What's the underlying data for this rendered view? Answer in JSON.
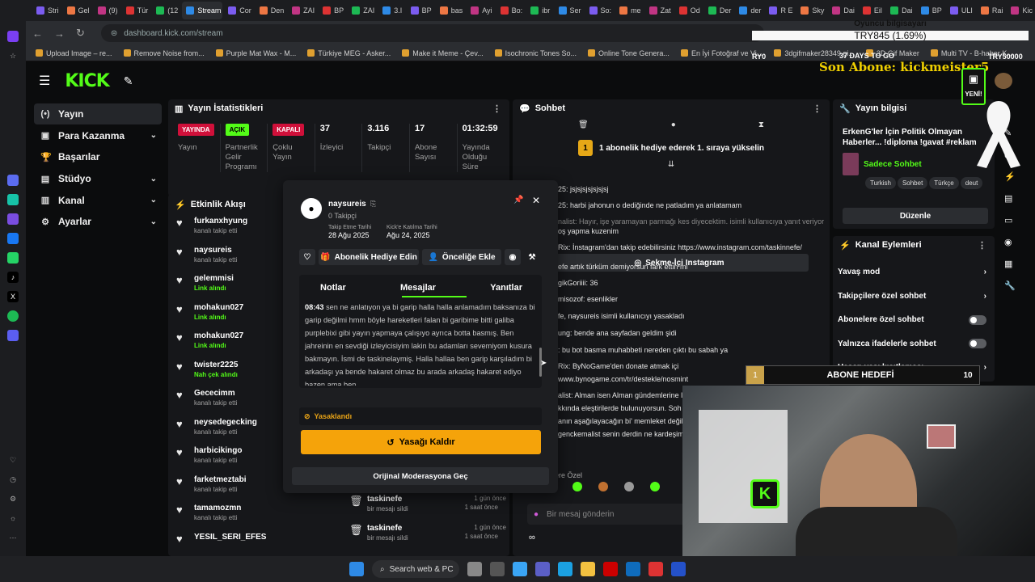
{
  "browser": {
    "tabs": [
      "Stri",
      "Gel",
      "(9)",
      "Tür",
      "(12",
      "Stream",
      "Cor",
      "Den",
      "ZAI",
      "BP",
      "ZAI",
      "3.I",
      "BP",
      "bas",
      "Ayi",
      "Bo:",
      "ibr",
      "Ser",
      "So:",
      "me",
      "Zat",
      "Od",
      "Der",
      "der",
      "R E",
      "Sky",
      "Dai",
      "Eil",
      "Dai",
      "BP",
      "ULI",
      "Rai",
      "Kic"
    ],
    "active_tab": "Stream",
    "url": "dashboard.kick.com/stream",
    "bookmarks": [
      "Upload Image – re...",
      "Remove Noise from...",
      "Purple Mat Wax - M...",
      "Türkiye MEG - Asker...",
      "Make it Meme - Çev...",
      "Isochronic Tones So...",
      "Online Tone Genera...",
      "En İyi Fotoğraf ve Vi...",
      "3dgifmaker28349.gi...",
      "3D Gif Maker",
      "Multi TV - B-haber K..."
    ]
  },
  "overlay": {
    "computer_label": "Oyuncu bilgisayarı",
    "goal_text": "TRY845 (1.69%)",
    "days_to_go": "37 DAYS TO GO",
    "goal_left": "RY0",
    "goal_right": "TRY50000",
    "last_sub": "Son Abone: kickmeister5",
    "new_label": "YENİ!"
  },
  "nav": {
    "items": [
      {
        "label": "Yayın",
        "icon": "(•)"
      },
      {
        "label": "Para Kazanma",
        "icon": "▣"
      },
      {
        "label": "Başarılar",
        "icon": "🏆"
      },
      {
        "label": "Stüdyo",
        "icon": "▤"
      },
      {
        "label": "Kanal",
        "icon": "▥"
      },
      {
        "label": "Ayarlar",
        "icon": "⚙"
      }
    ]
  },
  "stats": {
    "title": "Yayın İstatistikleri",
    "items": [
      {
        "badge": "YAYINDA",
        "label": "Yayın"
      },
      {
        "badge": "AÇIK",
        "label": "Partnerlik Gelir Programı"
      },
      {
        "badge": "KAPALI",
        "label": "Çoklu Yayın"
      },
      {
        "value": "37",
        "label": "İzleyici"
      },
      {
        "value": "3.116",
        "label": "Takipçi"
      },
      {
        "value": "17",
        "label": "Abone Sayısı"
      },
      {
        "value": "01:32:59",
        "label": "Yayında Olduğu Süre"
      }
    ]
  },
  "activity": {
    "title": "Etkinlik Akışı",
    "items": [
      {
        "name": "furkanxhyung",
        "sub": "kanalı takip etti",
        "green": false,
        "time": ""
      },
      {
        "name": "naysureis",
        "sub": "kanalı takip etti",
        "green": false,
        "time": ""
      },
      {
        "name": "gelemmisi",
        "sub": "Link alındı",
        "green": true,
        "time": ""
      },
      {
        "name": "mohakun027",
        "sub": "Link alındı",
        "green": true,
        "time": ""
      },
      {
        "name": "mohakun027",
        "sub": "Link alındı",
        "green": true,
        "time": ""
      },
      {
        "name": "twister2225",
        "sub": "Nah çek alındı",
        "green": true,
        "time": ""
      },
      {
        "name": "Gececimm",
        "sub": "kanalı takip etti",
        "green": false,
        "time": ""
      },
      {
        "name": "neysedegecking",
        "sub": "kanalı takip etti",
        "green": false,
        "time": ""
      },
      {
        "name": "harbicikingo",
        "sub": "kanalı takip etti",
        "green": false,
        "time": ""
      },
      {
        "name": "farketmeztabi",
        "sub": "kanalı takip etti",
        "green": false,
        "time": ""
      },
      {
        "name": "tamamozmn",
        "sub": "kanalı takip etti",
        "green": false,
        "time": "1 saat önce"
      },
      {
        "name": "YESIL_SERI_EFES",
        "sub": "",
        "green": false,
        "time": "1 saat önce"
      }
    ]
  },
  "modlog": {
    "items": [
      {
        "name": "taskinefe",
        "sub": "bir mesajı sildi",
        "time": "1 gün önce"
      },
      {
        "name": "taskinefe",
        "sub": "bir mesajı sildi",
        "time": "1 gün önce"
      }
    ]
  },
  "chat": {
    "title": "Sohbet",
    "promo": "1 abonelik hediye ederek 1. sıraya yükselin",
    "promo_num": "1",
    "lines": [
      "25: jsjsjsjsjsjsjsj",
      "25: harbi jahonun o dediğinde ne patladım ya anlatamam",
      "nalist: Hayır, işe yaramayan parmağı kes diyecektim. isimli kullanıcıya yanıt veriyor",
      "oş yapma kuzenim",
      "Rix: İnstagram'dan takip edebilirsiniz https://www.instagram.com/taskinnefe/",
      "efe artık türküm demiyorsun fark ettin mi",
      "gikGoriiii: 36",
      "misozof: esenlikler",
      "fe, naysureis isimli kullanıcıyı yasakladı",
      "ung: bende ana sayfadan geldim şidi",
      ": bu bot basma muhabbeti nereden çıktı bu sabah ya",
      "Rix: ByNoGame'den donate atmak içi",
      "www.bynogame.com/tr/destekle/nosmint",
      "alist: Alman isen Alman gündemlerine l",
      "kkında eleştirilerde bulunuyorsun. Soh",
      "anın aşağılayacağın bi' memleket değil,",
      "genckemalist senin derdin ne kardeşim"
    ],
    "instagram_btn": "Sekme-İçi Instagram",
    "special": "ere Özel",
    "input_placeholder": "Bir mesaj gönderin"
  },
  "popup": {
    "username": "naysureis",
    "followers": "0 Takipçi",
    "follow_date_label": "Takip Etme Tarihi",
    "follow_date": "28 Ağu 2025",
    "join_date_label": "Kick'e Katılma Tarihi",
    "join_date": "Ağu 24, 2025",
    "gift_btn": "Abonelik Hediye Edin",
    "priority_btn": "Önceliğe Ekle",
    "tabs": [
      "Notlar",
      "Mesajlar",
      "Yanıtlar"
    ],
    "active_tab": "Mesajlar",
    "message_time": "08:43",
    "message": "sen ne anlatıyon ya bi garip halla halla anlamadım baksanıza bi garip değilmi hmm böyle hareketleri falan bi garibime bitti galiba purplebixi gibi yayın yapmaya çalışıyo ayrıca botta basmış. Ben jahreinin en sevdiği izleyicisiyim lakin bu adamları sevemiyom kusura bakmayın. İsmi de taskinelaymiş. Halla hallaa ben garip karşıladım bi arkadaşı ya bende hakaret olmaz bu arada arkadaş hakaret ediyo bazen ama ben",
    "banned_label": "Yasaklandı",
    "unban_btn": "Yasağı Kaldır",
    "moderation_btn": "Orijinal Moderasyona Geç"
  },
  "stream_info": {
    "title": "Yayın bilgisi",
    "stream_title": "ErkenG'ler İçin Politik Olmayan Haberler... !diploma !gavat #reklam",
    "category": "Sadece Sohbet",
    "tags": [
      "Turkish",
      "Sohbet",
      "Türkçe",
      "deut"
    ],
    "edit_btn": "Düzenle"
  },
  "channel_actions": {
    "title": "Kanal Eylemleri",
    "items": [
      {
        "label": "Yavaş mod",
        "type": "chevron"
      },
      {
        "label": "Takipçilere özel sohbet",
        "type": "chevron"
      },
      {
        "label": "Abonelere özel sohbet",
        "type": "toggle"
      },
      {
        "label": "Yalnızca ifadelerle sohbet",
        "type": "toggle"
      },
      {
        "label": "Hesap yaşı kısıtlaması",
        "type": "chevron"
      }
    ]
  },
  "sub_goal": {
    "left": "1",
    "label": "ABONE HEDEFİ",
    "right": "10"
  },
  "taskbar": {
    "search": "Search web & PC"
  },
  "colors": {
    "kick_green": "#53fc18",
    "live_red": "#d0103a",
    "unban_orange": "#f5a30a",
    "overlay_yellow": "#f0d000"
  }
}
